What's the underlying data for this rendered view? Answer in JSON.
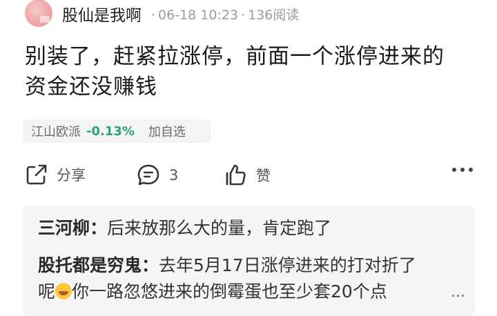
{
  "post": {
    "username": "股仙是我啊",
    "date": "06-18 10:23",
    "read_count": "136阅读",
    "content_line1": "别装了，赶紧拉涨停，前面一个涨停进来的",
    "content_line2": "资金还没赚钱"
  },
  "stock": {
    "name": "江山欧派",
    "change": "-0.13%",
    "add_label": "加自选",
    "change_color": "#2ea36b"
  },
  "actions": {
    "share_label": "分享",
    "comment_count": "3",
    "like_label": "赞",
    "more_icon": "more-dots-icon"
  },
  "replies": [
    {
      "name": "三河柳：",
      "text": "后来放那么大的量，肯定跑了"
    },
    {
      "name": "股托都是穷鬼：",
      "text_line1": "去年5月17日涨停进来的打对折了",
      "text_line2_pre": "呢",
      "text_line2_post": "你一路忽悠进来的倒霉蛋也至少套20个点"
    }
  ],
  "replies_more": "..."
}
